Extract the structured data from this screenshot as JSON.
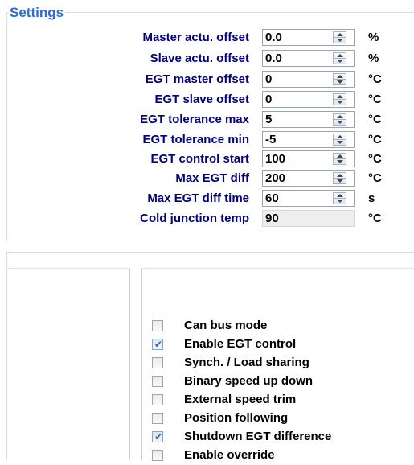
{
  "settings": {
    "title": "Settings",
    "rows": [
      {
        "label": "Master actu. offset",
        "value": "0.0",
        "unit": "%",
        "readonly": false
      },
      {
        "label": "Slave actu. offset",
        "value": "0.0",
        "unit": "%",
        "readonly": false
      },
      {
        "label": "EGT master offset",
        "value": "0",
        "unit": "°C",
        "readonly": false
      },
      {
        "label": "EGT slave offset",
        "value": "0",
        "unit": "°C",
        "readonly": false
      },
      {
        "label": "EGT tolerance max",
        "value": "5",
        "unit": "°C",
        "readonly": false
      },
      {
        "label": "EGT tolerance min",
        "value": "-5",
        "unit": "°C",
        "readonly": false
      },
      {
        "label": "EGT control start",
        "value": "100",
        "unit": "°C",
        "readonly": false
      },
      {
        "label": "Max EGT diff",
        "value": "200",
        "unit": "°C",
        "readonly": false
      },
      {
        "label": "Max EGT diff time",
        "value": "60",
        "unit": "s",
        "readonly": false
      },
      {
        "label": "Cold junction temp",
        "value": "90",
        "unit": "°C",
        "readonly": true
      }
    ]
  },
  "options": [
    {
      "label": "Can bus mode",
      "checked": false
    },
    {
      "label": "Enable EGT control",
      "checked": true
    },
    {
      "label": "Synch.  / Load sharing",
      "checked": false
    },
    {
      "label": "Binary speed up down",
      "checked": false
    },
    {
      "label": "External speed trim",
      "checked": false
    },
    {
      "label": "Position following",
      "checked": false
    },
    {
      "label": "Shutdown EGT difference",
      "checked": true
    },
    {
      "label": "Enable override",
      "checked": false
    }
  ],
  "icons": {
    "spinner": "spinner-up-down-icon",
    "checkmark": "checkmark-icon"
  },
  "colors": {
    "title": "#2a6fd0",
    "label": "#00007a"
  }
}
